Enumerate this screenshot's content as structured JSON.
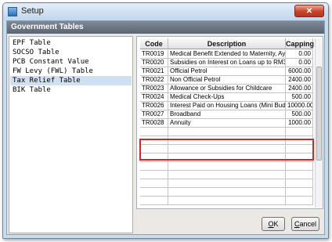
{
  "window": {
    "title": "Setup",
    "close_label": "✕"
  },
  "panel": {
    "header": "Government Tables"
  },
  "tree": {
    "selected_index": 4,
    "items": [
      {
        "label": "EPF Table"
      },
      {
        "label": "SOCSO Table"
      },
      {
        "label": "PCB Constant Value"
      },
      {
        "label": "FW Levy (FWL) Table"
      },
      {
        "label": "Tax Relief Table"
      },
      {
        "label": "BIK Table"
      }
    ]
  },
  "grid": {
    "columns": [
      "Code",
      "Description",
      "Capping"
    ],
    "rows": [
      {
        "code": "TR0019",
        "description": "Medical Benefit Extended to Maternity, Ayu",
        "capping": "0.00"
      },
      {
        "code": "TR0020",
        "description": "Subsidies on Interest on Loans up to RM3",
        "capping": "0.00"
      },
      {
        "code": "TR0021",
        "description": "Official Petrol",
        "capping": "6000.00"
      },
      {
        "code": "TR0022",
        "description": "Non Official Petrol",
        "capping": "2400.00"
      },
      {
        "code": "TR0023",
        "description": "Allowance or Subsidies for Childcare",
        "capping": "2400.00"
      },
      {
        "code": "TR0024",
        "description": "Medical Check-Ups",
        "capping": "500.00"
      },
      {
        "code": "TR0026",
        "description": "Interest Paid on Housing Loans (Mini Bud",
        "capping": "10000.00"
      },
      {
        "code": "TR0027",
        "description": "Broadband",
        "capping": "500.00"
      },
      {
        "code": "TR0028",
        "description": "Annuity",
        "capping": "1000.00"
      },
      {
        "code": "",
        "description": "",
        "capping": ""
      },
      {
        "code": "",
        "description": "",
        "capping": ""
      },
      {
        "code": "",
        "description": "",
        "capping": ""
      },
      {
        "code": "",
        "description": "",
        "capping": ""
      },
      {
        "code": "",
        "description": "",
        "capping": ""
      },
      {
        "code": "",
        "description": "",
        "capping": ""
      },
      {
        "code": "",
        "description": "",
        "capping": ""
      },
      {
        "code": "",
        "description": "",
        "capping": ""
      },
      {
        "code": "",
        "description": "",
        "capping": ""
      }
    ],
    "highlighted_codes": [
      "TR0027",
      "TR0028"
    ]
  },
  "buttons": {
    "ok": {
      "mnemonic": "O",
      "rest": "K"
    },
    "cancel": {
      "mnemonic": "C",
      "rest": "ancel"
    }
  },
  "colors": {
    "highlight_border": "#d2262b",
    "selection": "#cfe0f2",
    "header_bar": "#5b6470"
  }
}
